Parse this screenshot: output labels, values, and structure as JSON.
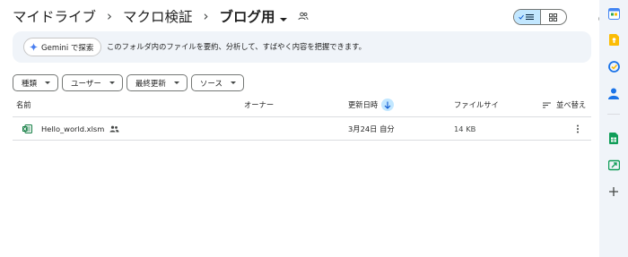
{
  "breadcrumb": {
    "items": [
      "マイドライブ",
      "マクロ検証",
      "ブログ用"
    ],
    "separator": "›"
  },
  "gemini": {
    "button_label": "Gemini で探索",
    "description": "このフォルダ内のファイルを要約、分析して、すばやく内容を把握できます。"
  },
  "filters": [
    "種類",
    "ユーザー",
    "最終更新",
    "ソース"
  ],
  "table": {
    "columns": {
      "name": "名前",
      "owner": "オーナー",
      "modified": "更新日時",
      "size": "ファイルサイ",
      "sort": "並べ替え"
    },
    "rows": [
      {
        "name": "Hello_world.xlsm",
        "owner": "",
        "modified": "3月24日 自分",
        "size": "14 KB"
      }
    ]
  },
  "rail_icons": [
    "calendar-icon",
    "keep-icon",
    "tasks-icon",
    "contacts-icon",
    "sheets-icon",
    "slides-icon",
    "add-icon"
  ],
  "colors": {
    "accent": "#c2e7ff",
    "excel_green": "#107c41",
    "background": "#f0f4f9"
  }
}
